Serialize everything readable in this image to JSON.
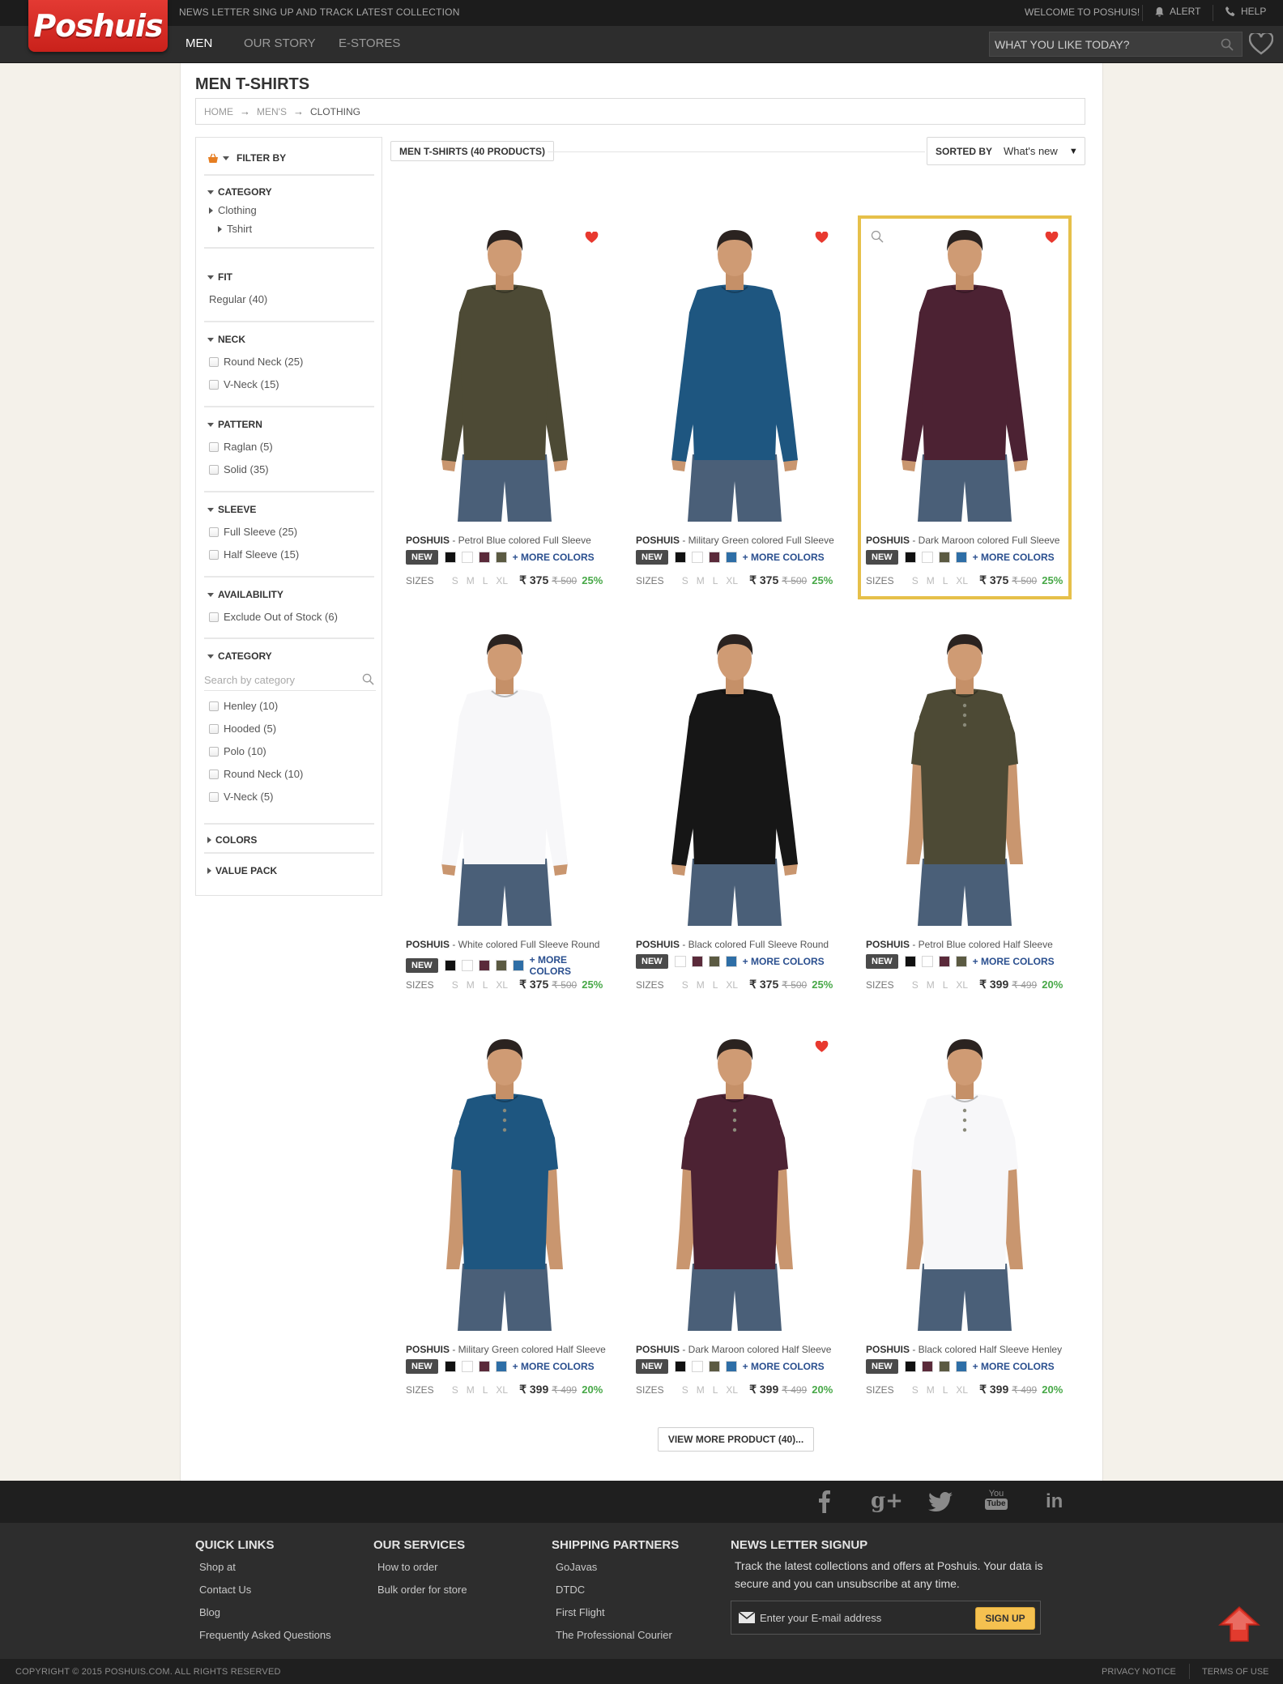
{
  "header": {
    "logo_text": "Poshuis",
    "promo": "NEWS LETTER SING UP AND TRACK LATEST COLLECTION",
    "welcome": "WELCOME TO POSHUIS!",
    "alert": "ALERT",
    "help": "HELP",
    "nav": [
      "MEN",
      "OUR STORY",
      "E-STORES"
    ],
    "search_placeholder": "WHAT YOU LIKE TODAY?"
  },
  "page": {
    "title": "MEN T-SHIRTS",
    "breadcrumb": [
      "HOME",
      "MEN'S",
      "CLOTHING"
    ]
  },
  "filters": {
    "filter_by": "FILTER BY",
    "category_head": "CATEGORY",
    "category_items": [
      "Clothing",
      "Tshirt"
    ],
    "fit_head": "FIT",
    "fit_items": [
      "Regular (40)"
    ],
    "neck_head": "NECK",
    "neck_items": [
      "Round Neck (25)",
      "V-Neck (15)"
    ],
    "pattern_head": "PATTERN",
    "pattern_items": [
      "Raglan (5)",
      "Solid (35)"
    ],
    "sleeve_head": "SLEEVE",
    "sleeve_items": [
      "Full Sleeve (25)",
      "Half Sleeve (15)"
    ],
    "availability_head": "AVAILABILITY",
    "availability_items": [
      "Exclude Out of Stock (6)"
    ],
    "category2_head": "CATEGORY",
    "category2_placeholder": "Search by category",
    "category2_items": [
      "Henley (10)",
      "Hooded (5)",
      "Polo (10)",
      "Round Neck (10)",
      "V-Neck (5)"
    ],
    "colors_head": "COLORS",
    "valuepack_head": "VALUE PACK"
  },
  "listing": {
    "count_label": "MEN T-SHIRTS  (40 PRODUCTS)",
    "sorted_label": "SORTED BY",
    "sorted_value": "What's new",
    "new_badge": "NEW",
    "more_colors": "+ MORE COLORS",
    "sizes_label": "SIZES",
    "sizes": [
      "S",
      "M",
      "L",
      "XL"
    ],
    "view_more": "VIEW MORE PRODUCT (40)..."
  },
  "colors": {
    "black": "#111111",
    "white": "#ffffff",
    "maroon": "#5a2a3a",
    "olive": "#5b5a42",
    "blue": "#2e6ea6",
    "highlight": "#e6c04a",
    "discount": "#47a847",
    "heart": "#e8392f"
  },
  "products": [
    {
      "brand": "POSHUIS",
      "name": " - Petrol Blue colored Full Sleeve",
      "price": "₹ 375",
      "old_price": "₹ 500",
      "discount": "25%",
      "shirt": "#4d4a35",
      "sleeve": "full",
      "neck": "round",
      "swatches": [
        "#111111",
        "#ffffff",
        "#5a2a3a",
        "#5b5a42"
      ],
      "wish": true,
      "highlight": false
    },
    {
      "brand": "POSHUIS",
      "name": " - Military Green colored Full Sleeve",
      "price": "₹ 375",
      "old_price": "₹ 500",
      "discount": "25%",
      "shirt": "#1e5680",
      "sleeve": "full",
      "neck": "round",
      "swatches": [
        "#111111",
        "#ffffff",
        "#5a2a3a",
        "#2e6ea6"
      ],
      "wish": true,
      "highlight": false
    },
    {
      "brand": "POSHUIS",
      "name": " - Dark Maroon colored Full Sleeve",
      "price": "₹ 375",
      "old_price": "₹ 500",
      "discount": "25%",
      "shirt": "#4c2233",
      "sleeve": "full",
      "neck": "round",
      "swatches": [
        "#111111",
        "#ffffff",
        "#5b5a42",
        "#2e6ea6"
      ],
      "wish": true,
      "highlight": true
    },
    {
      "brand": "POSHUIS",
      "name": " - White colored Full Sleeve Round",
      "price": "₹ 375",
      "old_price": "₹ 500",
      "discount": "25%",
      "shirt": "#f7f7f9",
      "sleeve": "full",
      "neck": "round",
      "swatches": [
        "#111111",
        "#ffffff",
        "#5a2a3a",
        "#5b5a42",
        "#2e6ea6"
      ],
      "wish": false,
      "highlight": false
    },
    {
      "brand": "POSHUIS",
      "name": " - Black colored Full Sleeve Round",
      "price": "₹ 375",
      "old_price": "₹ 500",
      "discount": "25%",
      "shirt": "#161616",
      "sleeve": "full",
      "neck": "round",
      "swatches": [
        "#ffffff",
        "#5a2a3a",
        "#5b5a42",
        "#2e6ea6"
      ],
      "wish": false,
      "highlight": false
    },
    {
      "brand": "POSHUIS",
      "name": " - Petrol Blue colored Half Sleeve",
      "price": "₹ 399",
      "old_price": "₹ 499",
      "discount": "20%",
      "shirt": "#4d4a35",
      "sleeve": "half",
      "neck": "henley",
      "swatches": [
        "#111111",
        "#ffffff",
        "#5a2a3a",
        "#5b5a42"
      ],
      "wish": false,
      "highlight": false
    },
    {
      "brand": "POSHUIS",
      "name": " - Military Green colored Half Sleeve",
      "price": "₹ 399",
      "old_price": "₹ 499",
      "discount": "20%",
      "shirt": "#1e5680",
      "sleeve": "half",
      "neck": "henley",
      "swatches": [
        "#111111",
        "#ffffff",
        "#5a2a3a",
        "#2e6ea6"
      ],
      "wish": false,
      "highlight": false
    },
    {
      "brand": "POSHUIS",
      "name": " - Dark Maroon colored Half Sleeve",
      "price": "₹ 399",
      "old_price": "₹ 499",
      "discount": "20%",
      "shirt": "#4c2233",
      "sleeve": "half",
      "neck": "henley",
      "swatches": [
        "#111111",
        "#ffffff",
        "#5b5a42",
        "#2e6ea6"
      ],
      "wish": true,
      "highlight": false
    },
    {
      "brand": "POSHUIS",
      "name": " - Black colored Half Sleeve Henley",
      "price": "₹ 399",
      "old_price": "₹ 499",
      "discount": "20%",
      "shirt": "#f7f7f9",
      "sleeve": "half",
      "neck": "henley",
      "swatches": [
        "#111111",
        "#5a2a3a",
        "#5b5a42",
        "#2e6ea6"
      ],
      "wish": false,
      "highlight": false
    }
  ],
  "footer": {
    "social": [
      "facebook-icon",
      "google-plus-icon",
      "twitter-icon",
      "youtube-icon",
      "linkedin-icon"
    ],
    "youtube_text": "You Tube",
    "quick_links_head": "QUICK LINKS",
    "quick_links": [
      "Shop at",
      "Contact Us",
      "Blog",
      "Frequently Asked Questions"
    ],
    "services_head": "OUR SERVICES",
    "services": [
      "How to order",
      "Bulk order for store"
    ],
    "shipping_head": "SHIPPING PARTNERS",
    "shipping": [
      "GoJavas",
      "DTDC",
      "First Flight",
      "The Professional Courier"
    ],
    "newsletter_head": "NEWS LETTER SIGNUP",
    "newsletter_text": "Track the latest collections and offers at Poshuis. Your data is secure and you can unsubscribe at any time.",
    "email_placeholder": "Enter your E-mail address",
    "signup": "SIGN UP",
    "copyright": "COPYRIGHT © 2015 POSHUIS.COM. ALL RIGHTS RESERVED",
    "privacy": "PRIVACY NOTICE",
    "terms": "TERMS OF USE"
  }
}
